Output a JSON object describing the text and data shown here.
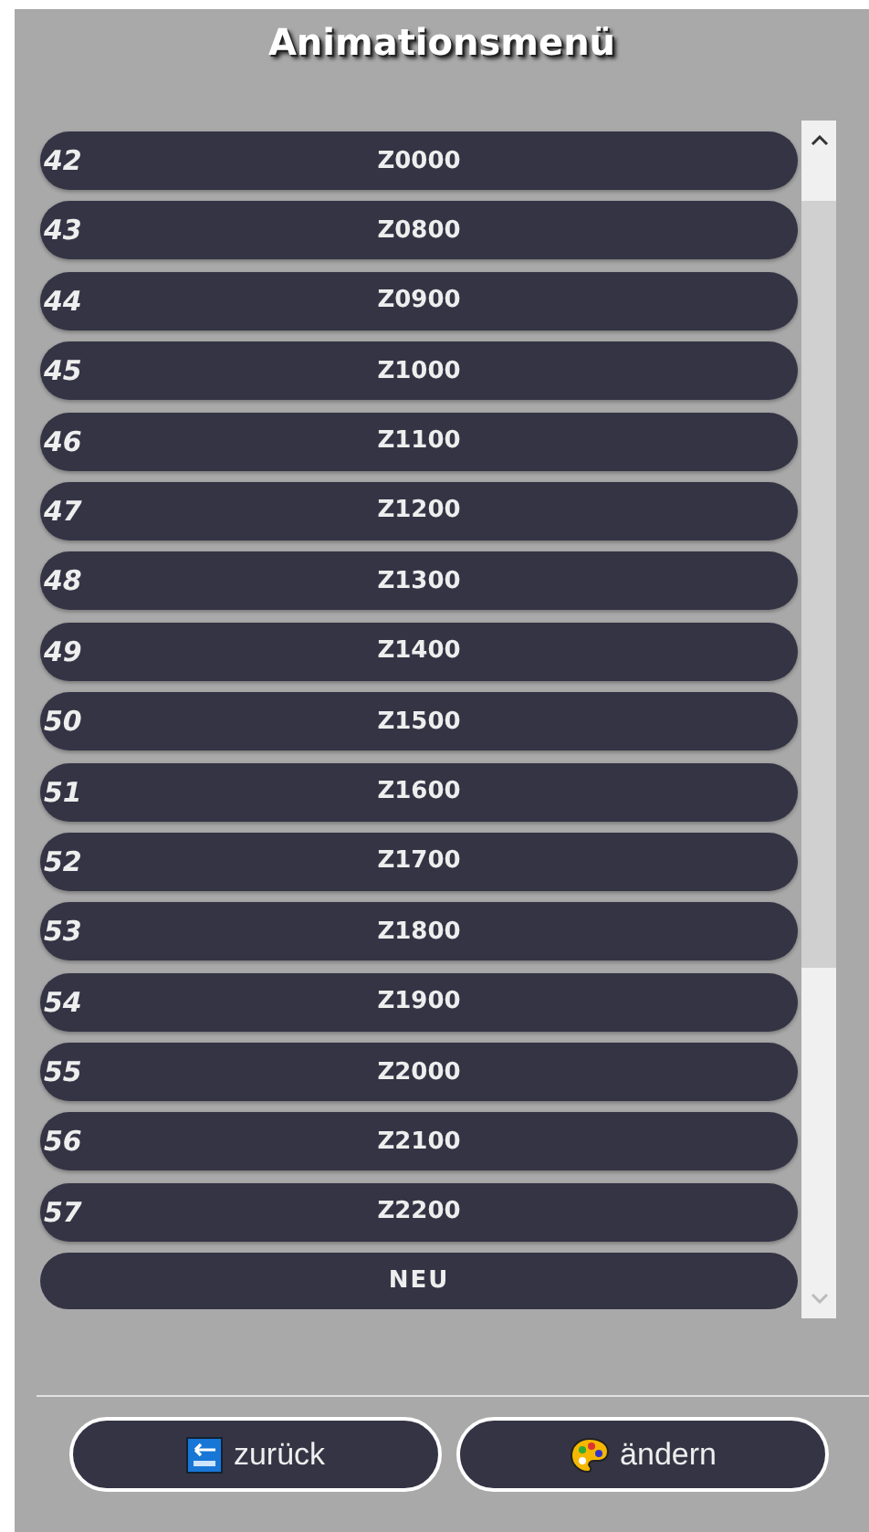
{
  "title": "Animationsmenü",
  "items": [
    {
      "number": "42",
      "name": "Z0000"
    },
    {
      "number": "43",
      "name": "Z0800"
    },
    {
      "number": "44",
      "name": "Z0900"
    },
    {
      "number": "45",
      "name": "Z1000"
    },
    {
      "number": "46",
      "name": "Z1100"
    },
    {
      "number": "47",
      "name": "Z1200"
    },
    {
      "number": "48",
      "name": "Z1300"
    },
    {
      "number": "49",
      "name": "Z1400"
    },
    {
      "number": "50",
      "name": "Z1500"
    },
    {
      "number": "51",
      "name": "Z1600"
    },
    {
      "number": "52",
      "name": "Z1700"
    },
    {
      "number": "53",
      "name": "Z1800"
    },
    {
      "number": "54",
      "name": "Z1900"
    },
    {
      "number": "55",
      "name": "Z2000"
    },
    {
      "number": "56",
      "name": "Z2100"
    },
    {
      "number": "57",
      "name": "Z2200"
    }
  ],
  "new_button": "NEU",
  "buttons": [
    {
      "kind": "back",
      "label": "zurück"
    },
    {
      "kind": "edit",
      "label": "ändern"
    }
  ]
}
